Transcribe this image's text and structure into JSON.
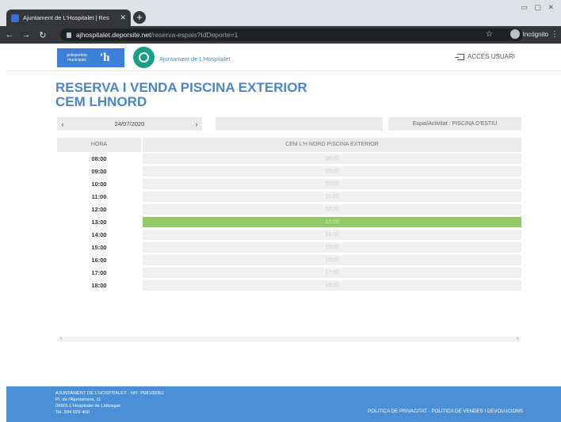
{
  "browser": {
    "tab_title": "Ajuntament de L'Hospitalet | Res",
    "url_host": "ajhospitalet.deporsite.net",
    "url_path": "/reserva-espais?IdDeporte=1",
    "incognito_label": "Incógnito"
  },
  "site": {
    "logo_text": "polisportius municipals",
    "org_name": "Ajuntament de L'Hospitalet",
    "login_label": "ACCÉS USUARI"
  },
  "page": {
    "title_line1": "RESERVA I VENDA PISCINA EXTERIOR",
    "title_line2": "CEM LHNORD",
    "date": "24/07/2020",
    "espai_label": "Espai/Activitat : PISCINA D'ESTIU"
  },
  "table": {
    "col_hour": "HORA",
    "col_space": "CEM L'H NORD PISCINA EXTERIOR",
    "selected_index": 5,
    "rows": [
      {
        "hour": "08:00",
        "slot": "08:00"
      },
      {
        "hour": "09:00",
        "slot": "09:00"
      },
      {
        "hour": "10:00",
        "slot": "10:00"
      },
      {
        "hour": "11:00",
        "slot": "11:00"
      },
      {
        "hour": "12:00",
        "slot": "12:00"
      },
      {
        "hour": "13:00",
        "slot": "13:00"
      },
      {
        "hour": "14:00",
        "slot": "14:00"
      },
      {
        "hour": "15:00",
        "slot": "15:00"
      },
      {
        "hour": "16:00",
        "slot": "16:00"
      },
      {
        "hour": "17:00",
        "slot": "17:00"
      },
      {
        "hour": "18:00",
        "slot": "18:00"
      }
    ]
  },
  "footer": {
    "line1": "AJUNTAMENT DE L'HOSPITALET · NIF: P0810000J",
    "line2": "Pl. de l'Ajuntament, 11",
    "line3": "08901 L'Hospitalet de Llobregat",
    "line4": "Tel. 934 029 400",
    "links": "POLITICA DE PRIVACITAT · POLITICA DE VENDES I DEVOLUCIONS"
  },
  "colors": {
    "accent": "#4a86c8",
    "selected_slot": "#93c96b",
    "footer_bg": "#4b8fd6"
  }
}
